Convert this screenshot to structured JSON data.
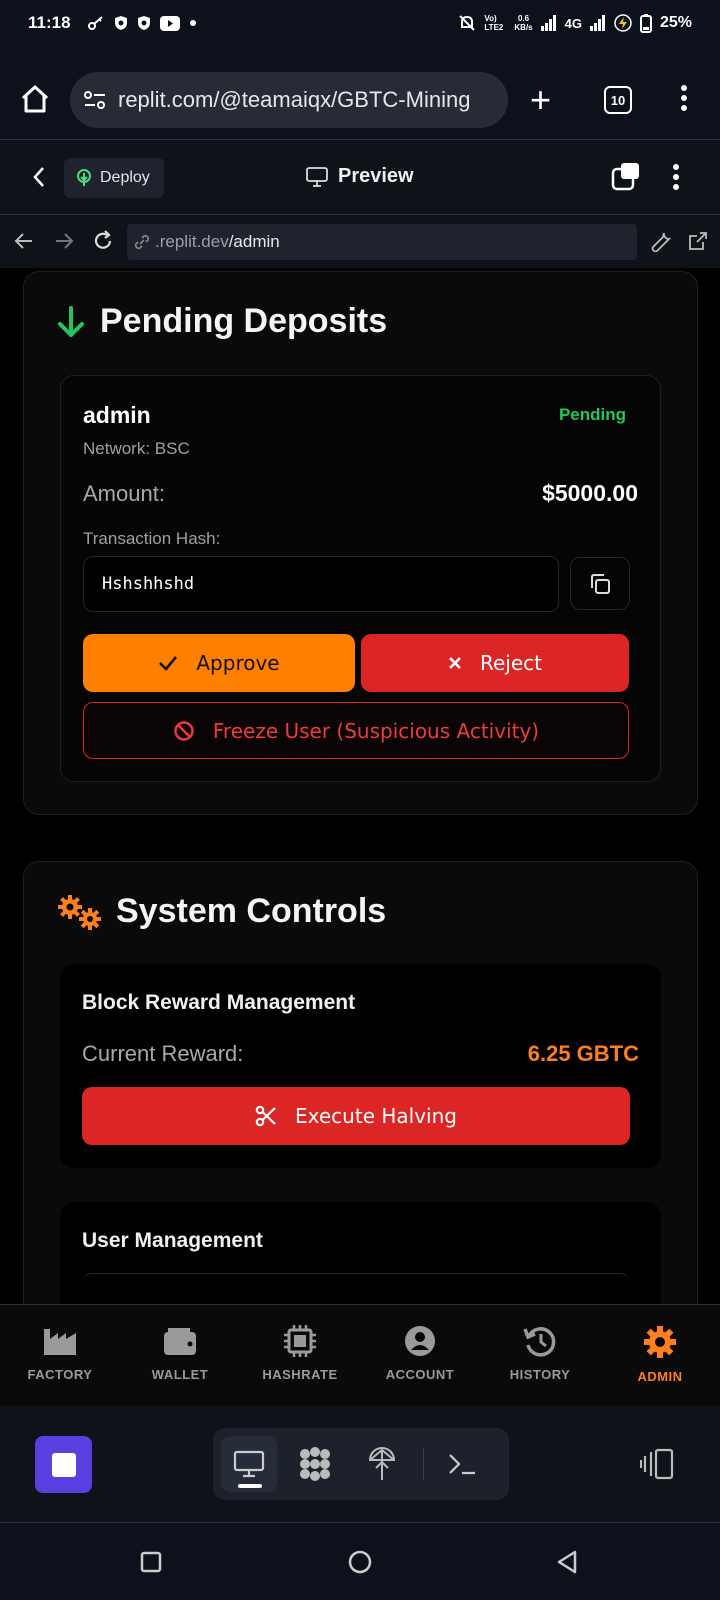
{
  "status_bar": {
    "time": "11:18",
    "battery": "25%",
    "network": "4G",
    "speed": "0.6",
    "speed_unit": "KB/s",
    "volte": "Vo) LTE2"
  },
  "browser": {
    "url": "replit.com/@teamaiqx/GBTC-Mining",
    "tab_count": "10"
  },
  "replit_header": {
    "deploy_label": "Deploy",
    "preview_label": "Preview"
  },
  "webview": {
    "url_host": ".replit.dev",
    "url_path": "/admin"
  },
  "pending_deposits": {
    "title": "Pending Deposits",
    "deposit": {
      "user": "admin",
      "status": "Pending",
      "network": "Network: BSC",
      "amount_label": "Amount:",
      "amount": "$5000.00",
      "hash_label": "Transaction Hash:",
      "hash_value": "Hshshhshd",
      "approve_label": "Approve",
      "reject_label": "Reject",
      "freeze_label": "Freeze User (Suspicious Activity)"
    }
  },
  "system_controls": {
    "title": "System Controls",
    "block_reward": {
      "title": "Block Reward Management",
      "current_label": "Current Reward:",
      "current_value": "6.25 GBTC",
      "halving_label": "Execute Halving"
    },
    "user_management": {
      "title": "User Management"
    }
  },
  "bottom_nav": [
    {
      "label": "FACTORY",
      "icon": "factory-icon"
    },
    {
      "label": "WALLET",
      "icon": "wallet-icon"
    },
    {
      "label": "HASHRATE",
      "icon": "chip-icon"
    },
    {
      "label": "ACCOUNT",
      "icon": "user-circle-icon"
    },
    {
      "label": "HISTORY",
      "icon": "history-icon"
    },
    {
      "label": "ADMIN",
      "icon": "gear-icon",
      "active": true
    }
  ],
  "colors": {
    "accent": "#ff7f1e",
    "danger": "#dc2626",
    "success": "#22c55e",
    "replit_purple": "#5a3fe0"
  }
}
